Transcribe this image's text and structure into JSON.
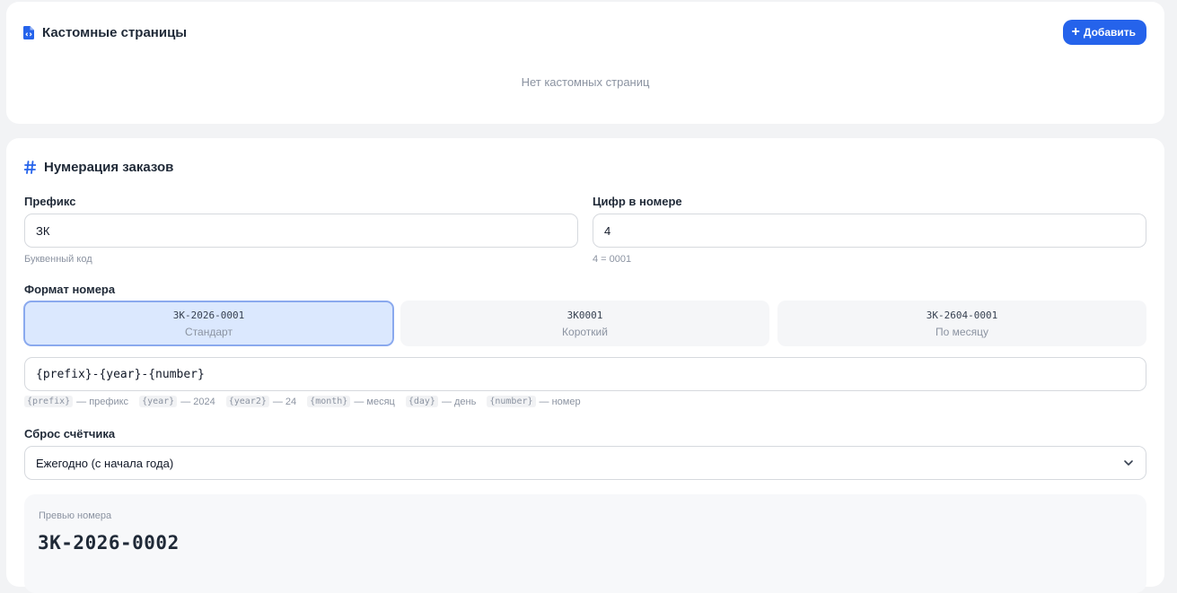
{
  "custom_pages": {
    "title": "Кастомные страницы",
    "icon": "file-code-icon",
    "add_label": "Добавить",
    "empty_text": "Нет кастомных страниц"
  },
  "order_numbering": {
    "title": "Нумерация заказов",
    "icon": "hash-icon",
    "prefix": {
      "label": "Префикс",
      "value": "ЗК",
      "hint": "Буквенный код"
    },
    "digits": {
      "label": "Цифр в номере",
      "value": "4",
      "hint": "4 = 0001"
    },
    "format": {
      "label": "Формат номера",
      "options": [
        {
          "code": "ЗК-2026-0001",
          "caption": "Стандарт",
          "selected": true
        },
        {
          "code": "ЗК0001",
          "caption": "Короткий",
          "selected": false
        },
        {
          "code": "ЗК-2604-0001",
          "caption": "По месяцу",
          "selected": false
        }
      ],
      "template": "{prefix}-{year}-{number}",
      "legend": [
        {
          "token": "{prefix}",
          "desc": "— префикс"
        },
        {
          "token": "{year}",
          "desc": "— 2024"
        },
        {
          "token": "{year2}",
          "desc": "— 24"
        },
        {
          "token": "{month}",
          "desc": "— месяц"
        },
        {
          "token": "{day}",
          "desc": "— день"
        },
        {
          "token": "{number}",
          "desc": "— номер"
        }
      ]
    },
    "reset": {
      "label": "Сброс счётчика",
      "value": "Ежегодно (с начала года)"
    },
    "preview": {
      "label": "Превью номера",
      "value": "ЗК-2026-0002"
    }
  },
  "colors": {
    "accent": "#2563eb",
    "selected_bg": "#dbe8fe",
    "selected_border": "#8aa9ee"
  }
}
